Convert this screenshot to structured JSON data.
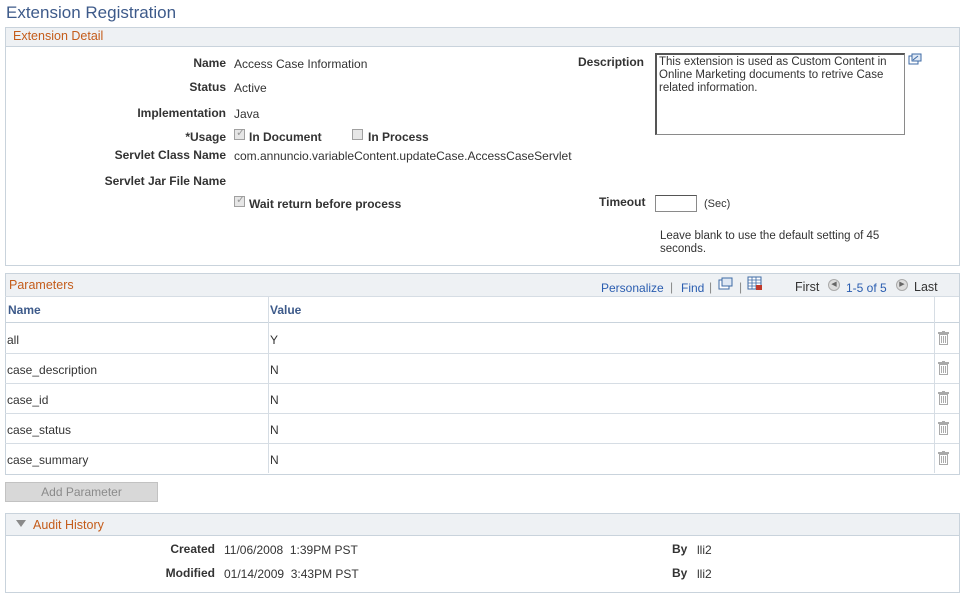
{
  "page": {
    "title": "Extension Registration"
  },
  "detail": {
    "section_title": "Extension Detail",
    "name_label": "Name",
    "name_value": "Access Case Information",
    "status_label": "Status",
    "status_value": "Active",
    "implementation_label": "Implementation",
    "implementation_value": "Java",
    "usage_label": "*Usage",
    "in_document_label": "In Document",
    "in_document_checked": true,
    "in_process_label": "In Process",
    "in_process_checked": false,
    "servlet_class_label": "Servlet Class Name",
    "servlet_class_value": "com.annuncio.variableContent.updateCase.AccessCaseServlet",
    "servlet_jar_label": "Servlet Jar File Name",
    "servlet_jar_value": "",
    "wait_return_label": "Wait return before process",
    "wait_return_checked": true,
    "description_label": "Description",
    "description_value": "This extension is used as Custom Content in Online Marketing documents to retrive Case related information.",
    "timeout_label": "Timeout",
    "timeout_value": "",
    "timeout_unit": "(Sec)",
    "timeout_hint": "Leave blank to use the default setting of 45 seconds."
  },
  "parameters": {
    "section_title": "Parameters",
    "personalize": "Personalize",
    "find": "Find",
    "separator": "|",
    "first": "First",
    "range": "1-5 of 5",
    "last": "Last",
    "columns": [
      "Name",
      "Value"
    ],
    "rows": [
      {
        "name": "all",
        "value": "Y"
      },
      {
        "name": "case_description",
        "value": "N"
      },
      {
        "name": "case_id",
        "value": "N"
      },
      {
        "name": "case_status",
        "value": "N"
      },
      {
        "name": "case_summary",
        "value": "N"
      }
    ],
    "add_button": "Add Parameter"
  },
  "audit": {
    "section_title": "Audit History",
    "created_label": "Created",
    "created_value": "11/06/2008  1:39PM PST",
    "created_by_label": "By",
    "created_by_value": "lli2",
    "modified_label": "Modified",
    "modified_value": "01/14/2009  3:43PM PST",
    "modified_by_label": "By",
    "modified_by_value": "lli2"
  },
  "icons": {
    "expand": "expand-window-icon",
    "new_window": "new-window-icon",
    "download": "download-grid-icon",
    "delete": "trash-icon",
    "collapse": "collapse-triangle-icon",
    "prev": "previous-arrow-icon",
    "next": "next-arrow-icon"
  },
  "colors": {
    "title": "#3d5a8a",
    "section_title": "#c45c1a",
    "link": "#2a5db0",
    "header_bg": "#eef1f4"
  }
}
